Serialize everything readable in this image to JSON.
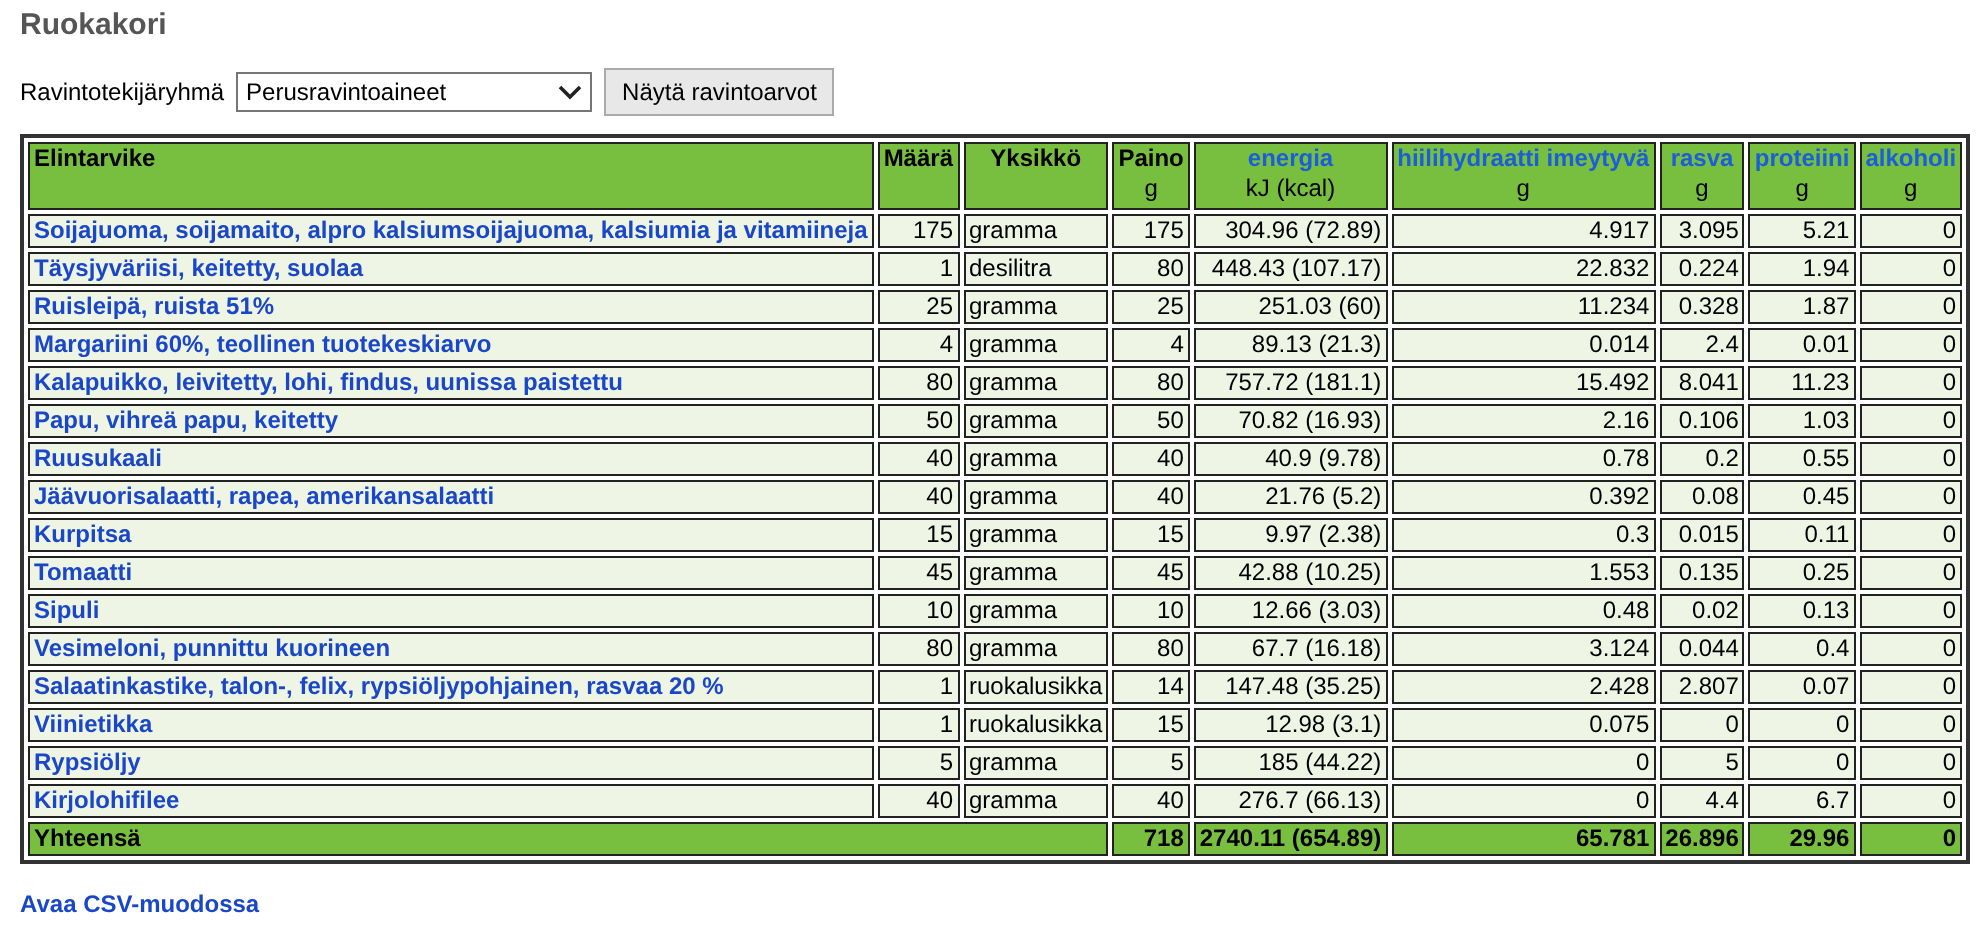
{
  "title": "Ruokakori",
  "filter": {
    "label": "Ravintotekijäryhmä",
    "value": "Perusravintoaineet",
    "button": "Näytä ravintoarvot"
  },
  "table": {
    "columns": [
      {
        "label": "Elintarvike",
        "kind": "plain"
      },
      {
        "label": "Määrä",
        "kind": "plain"
      },
      {
        "label": "Yksikkö",
        "kind": "plain"
      },
      {
        "label": "Paino",
        "unit": "g",
        "kind": "plain"
      },
      {
        "label": "energia",
        "unit": "kJ (kcal)",
        "kind": "link"
      },
      {
        "label": "hiilihydraatti imeytyvä",
        "unit": "g",
        "kind": "link"
      },
      {
        "label": "rasva",
        "unit": "g",
        "kind": "link"
      },
      {
        "label": "proteiini",
        "unit": "g",
        "kind": "link"
      },
      {
        "label": "alkoholi",
        "unit": "g",
        "kind": "link"
      }
    ],
    "rows": [
      [
        "Soijajuoma, soijamaito, alpro kalsiumsoijajuoma, kalsiumia ja vitamiineja",
        "175",
        "gramma",
        "175",
        "304.96 (72.89)",
        "4.917",
        "3.095",
        "5.21",
        "0"
      ],
      [
        "Täysjyväriisi, keitetty, suolaa",
        "1",
        "desilitra",
        "80",
        "448.43 (107.17)",
        "22.832",
        "0.224",
        "1.94",
        "0"
      ],
      [
        "Ruisleipä, ruista 51%",
        "25",
        "gramma",
        "25",
        "251.03 (60)",
        "11.234",
        "0.328",
        "1.87",
        "0"
      ],
      [
        "Margariini 60%, teollinen tuotekeskiarvo",
        "4",
        "gramma",
        "4",
        "89.13 (21.3)",
        "0.014",
        "2.4",
        "0.01",
        "0"
      ],
      [
        "Kalapuikko, leivitetty, lohi, findus, uunissa paistettu",
        "80",
        "gramma",
        "80",
        "757.72 (181.1)",
        "15.492",
        "8.041",
        "11.23",
        "0"
      ],
      [
        "Papu, vihreä papu, keitetty",
        "50",
        "gramma",
        "50",
        "70.82 (16.93)",
        "2.16",
        "0.106",
        "1.03",
        "0"
      ],
      [
        "Ruusukaali",
        "40",
        "gramma",
        "40",
        "40.9 (9.78)",
        "0.78",
        "0.2",
        "0.55",
        "0"
      ],
      [
        "Jäävuorisalaatti, rapea, amerikansalaatti",
        "40",
        "gramma",
        "40",
        "21.76 (5.2)",
        "0.392",
        "0.08",
        "0.45",
        "0"
      ],
      [
        "Kurpitsa",
        "15",
        "gramma",
        "15",
        "9.97 (2.38)",
        "0.3",
        "0.015",
        "0.11",
        "0"
      ],
      [
        "Tomaatti",
        "45",
        "gramma",
        "45",
        "42.88 (10.25)",
        "1.553",
        "0.135",
        "0.25",
        "0"
      ],
      [
        "Sipuli",
        "10",
        "gramma",
        "10",
        "12.66 (3.03)",
        "0.48",
        "0.02",
        "0.13",
        "0"
      ],
      [
        "Vesimeloni, punnittu kuorineen",
        "80",
        "gramma",
        "80",
        "67.7 (16.18)",
        "3.124",
        "0.044",
        "0.4",
        "0"
      ],
      [
        "Salaatinkastike, talon-, felix, rypsiöljypohjainen, rasvaa 20 %",
        "1",
        "ruokalusikka",
        "14",
        "147.48 (35.25)",
        "2.428",
        "2.807",
        "0.07",
        "0"
      ],
      [
        "Viinietikka",
        "1",
        "ruokalusikka",
        "15",
        "12.98 (3.1)",
        "0.075",
        "0",
        "0",
        "0"
      ],
      [
        "Rypsiöljy",
        "5",
        "gramma",
        "5",
        "185 (44.22)",
        "0",
        "5",
        "0",
        "0"
      ],
      [
        "Kirjolohifilee",
        "40",
        "gramma",
        "40",
        "276.7 (66.13)",
        "0",
        "4.4",
        "6.7",
        "0"
      ]
    ],
    "total": {
      "label": "Yhteensä",
      "values": [
        "718",
        "2740.11 (654.89)",
        "65.781",
        "26.896",
        "29.96",
        "0"
      ]
    }
  },
  "csv_link": "Avaa CSV-muodossa"
}
